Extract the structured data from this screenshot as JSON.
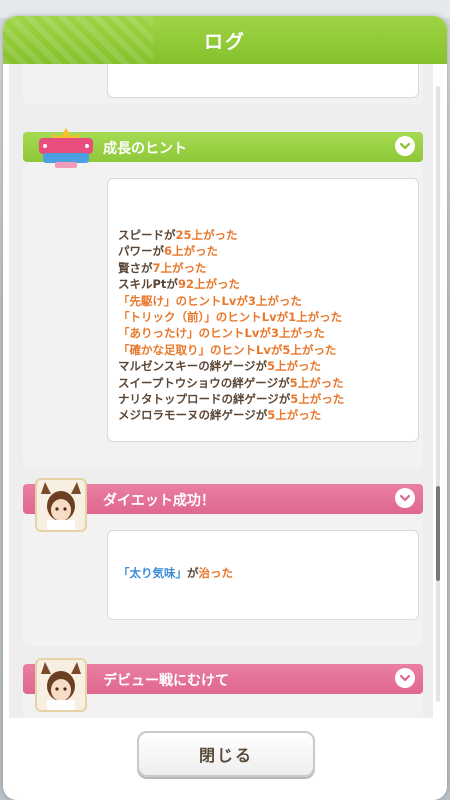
{
  "title": "ログ",
  "entries": [
    {
      "id": "growth-hint",
      "header": "成長のヒント",
      "header_color": "#8ec93a",
      "lines": [
        [
          {
            "t": "スピードが"
          },
          {
            "t": "25上がった",
            "hl": true
          }
        ],
        [
          {
            "t": "パワーが"
          },
          {
            "t": "6上がった",
            "hl": true
          }
        ],
        [
          {
            "t": "賢さが"
          },
          {
            "t": "7上がった",
            "hl": true
          }
        ],
        [
          {
            "t": "スキルPtが"
          },
          {
            "t": "92上がった",
            "hl": true
          }
        ],
        [
          {
            "t": "「先駆け」のヒントLvが3上がった",
            "hl": true
          }
        ],
        [
          {
            "t": "「トリック（前）」のヒントLvが1上がった",
            "hl": true
          }
        ],
        [
          {
            "t": "「ありったけ」のヒントLvが3上がった",
            "hl": true
          }
        ],
        [
          {
            "t": "「確かな足取り」のヒントLvが5上がった",
            "hl": true
          }
        ],
        [
          {
            "t": "マルゼンスキーの絆ゲージが"
          },
          {
            "t": "5上がった",
            "hl": true
          }
        ],
        [
          {
            "t": "スイープトウショウの絆ゲージが"
          },
          {
            "t": "5上がった",
            "hl": true
          }
        ],
        [
          {
            "t": "ナリタトップロードの絆ゲージが"
          },
          {
            "t": "5上がった",
            "hl": true
          }
        ],
        [
          {
            "t": "メジロラモーヌの絆ゲージが"
          },
          {
            "t": "5上がった",
            "hl": true
          }
        ]
      ]
    },
    {
      "id": "diet-success",
      "header": "ダイエット成功！",
      "header_color": "#df6790",
      "lines": [
        [
          {
            "t": "「太り気味」",
            "blue": true
          },
          {
            "t": "が"
          },
          {
            "t": "治った",
            "hl": true
          }
        ]
      ]
    },
    {
      "id": "debut-race",
      "header": "デビュー戦にむけて",
      "header_color": "#df6790",
      "lines": []
    }
  ],
  "close_label": "閉じる",
  "icons": {
    "expand": "chevron-down-icon",
    "scenario_logo": "grand-masters-logo",
    "character": "character-portrait"
  },
  "colors": {
    "header_green": "#8ec93a",
    "header_pink": "#df6790",
    "highlight": "#e8782b",
    "blue_highlight": "#3a8bd6",
    "text": "#5b4636"
  }
}
